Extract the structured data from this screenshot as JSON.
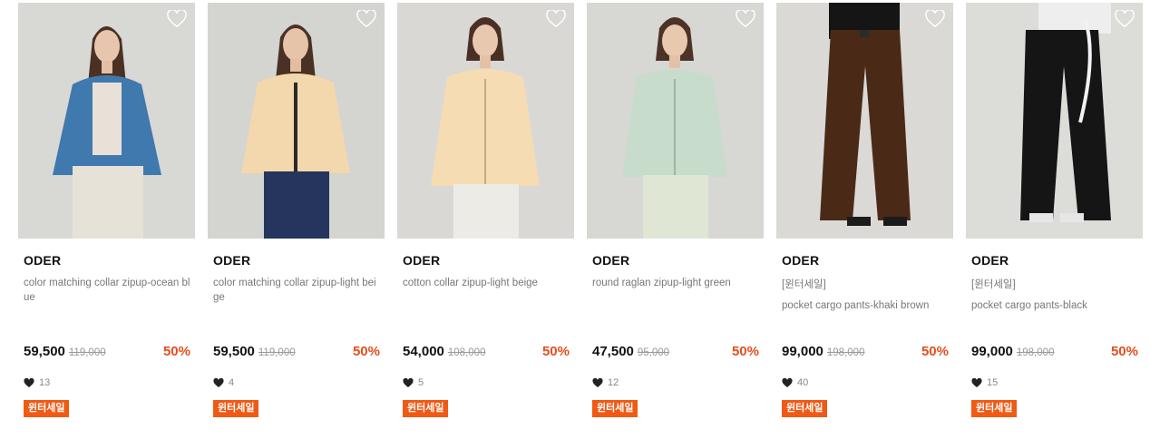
{
  "products": [
    {
      "brand": "ODER",
      "tag": "",
      "name": "color matching collar zipup-ocean blue",
      "price": "59,500",
      "original_price": "119,000",
      "discount": "50%",
      "likes": "13",
      "badge": "윈터세일",
      "icon": "heart-outline-icon",
      "garment_color": "#3f79ad",
      "bottom_color": "#e7e2d8"
    },
    {
      "brand": "ODER",
      "tag": "",
      "name": "color matching collar zipup-light beige",
      "price": "59,500",
      "original_price": "119,000",
      "discount": "50%",
      "likes": "4",
      "badge": "윈터세일",
      "icon": "heart-outline-icon",
      "garment_color": "#f3d8ad",
      "bottom_color": "#25355e"
    },
    {
      "brand": "ODER",
      "tag": "",
      "name": "cotton collar zipup-light beige",
      "price": "54,000",
      "original_price": "108,000",
      "discount": "50%",
      "likes": "5",
      "badge": "윈터세일",
      "icon": "heart-outline-icon",
      "garment_color": "#f6dcb2",
      "bottom_color": "#ecebe6"
    },
    {
      "brand": "ODER",
      "tag": "",
      "name": "round raglan zipup-light green",
      "price": "47,500",
      "original_price": "95,000",
      "discount": "50%",
      "likes": "12",
      "badge": "윈터세일",
      "icon": "heart-outline-icon",
      "garment_color": "#c7dccb",
      "bottom_color": "#dfe6d4"
    },
    {
      "brand": "ODER",
      "tag": "[윈터세일]",
      "name": "pocket cargo pants-khaki brown",
      "price": "99,000",
      "original_price": "198,000",
      "discount": "50%",
      "likes": "40",
      "badge": "윈터세일",
      "icon": "heart-outline-icon",
      "garment_color": "#4a2a17",
      "bottom_color": "#111111"
    },
    {
      "brand": "ODER",
      "tag": "[윈터세일]",
      "name": "pocket cargo pants-black",
      "price": "99,000",
      "original_price": "198,000",
      "discount": "50%",
      "likes": "15",
      "badge": "윈터세일",
      "icon": "heart-outline-icon",
      "garment_color": "#151515",
      "bottom_color": "#eeeeee"
    }
  ],
  "colors": {
    "discount": "#e84d1c",
    "badge_bg": "#f05a14",
    "photo_bg": "#d6d6d3"
  }
}
